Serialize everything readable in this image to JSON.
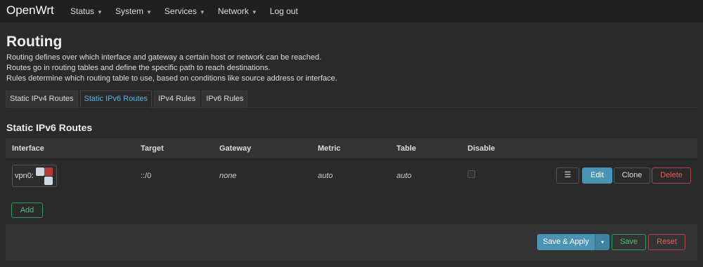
{
  "header": {
    "brand": "OpenWrt",
    "nav": [
      {
        "label": "Status",
        "has_menu": true
      },
      {
        "label": "System",
        "has_menu": true
      },
      {
        "label": "Services",
        "has_menu": true
      },
      {
        "label": "Network",
        "has_menu": true
      },
      {
        "label": "Log out",
        "has_menu": false
      }
    ]
  },
  "page": {
    "title": "Routing",
    "description": [
      "Routing defines over which interface and gateway a certain host or network can be reached.",
      "Routes go in routing tables and define the specific path to reach destinations.",
      "Rules determine which routing table to use, based on conditions like source address or interface."
    ]
  },
  "tabs": [
    {
      "label": "Static IPv4 Routes",
      "active": false
    },
    {
      "label": "Static IPv6 Routes",
      "active": true
    },
    {
      "label": "IPv4 Rules",
      "active": false
    },
    {
      "label": "IPv6 Rules",
      "active": false
    }
  ],
  "section": {
    "title": "Static IPv6 Routes",
    "columns": [
      "Interface",
      "Target",
      "Gateway",
      "Metric",
      "Table",
      "Disable"
    ],
    "rows": [
      {
        "interface": "vpn0:",
        "target": "::/0",
        "gateway": "none",
        "metric": "auto",
        "table": "auto",
        "disabled": false
      }
    ],
    "row_actions": {
      "sort": "☰",
      "edit": "Edit",
      "clone": "Clone",
      "delete": "Delete"
    },
    "add_label": "Add"
  },
  "footer": {
    "save_apply": "Save & Apply",
    "dropdown": "▾",
    "save": "Save",
    "reset": "Reset"
  },
  "colors": {
    "accent": "#4a93b5",
    "positive": "#4cc07a",
    "negative": "#e06060",
    "active_tab": "#5fb3d9"
  }
}
